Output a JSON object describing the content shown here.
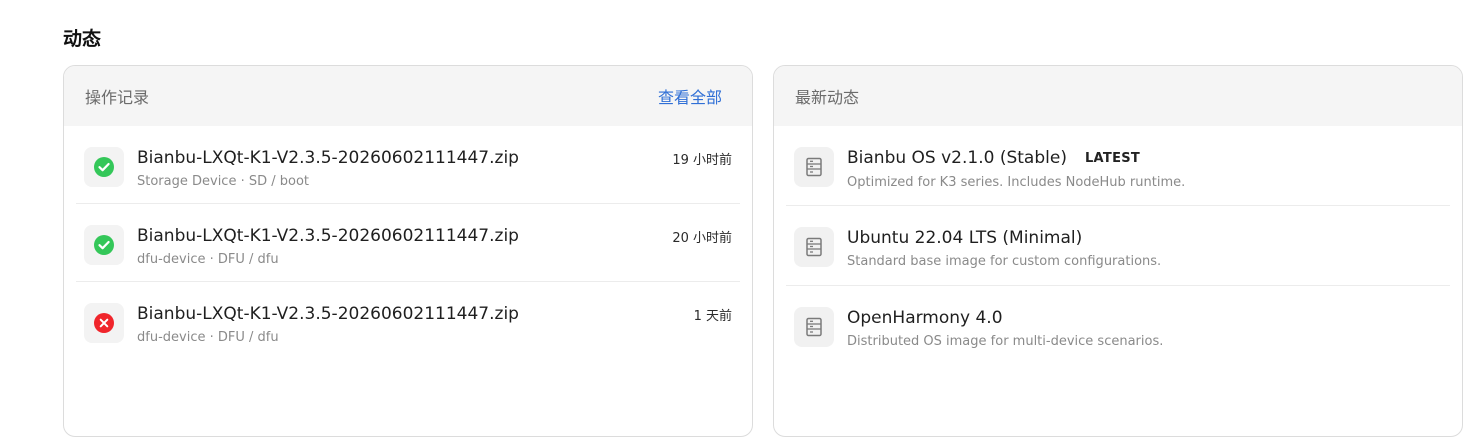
{
  "section": {
    "title": "动态"
  },
  "operations": {
    "title": "操作记录",
    "view_all": "查看全部",
    "items": [
      {
        "status": "success",
        "icon": "check-circle-icon",
        "name": "Bianbu-LXQt-K1-V2.3.5-20260602111447.zip",
        "target": "Storage Device · SD / boot",
        "time": "19 小时前"
      },
      {
        "status": "success",
        "icon": "check-circle-icon",
        "name": "Bianbu-LXQt-K1-V2.3.5-20260602111447.zip",
        "target": "dfu-device · DFU / dfu",
        "time": "20 小时前"
      },
      {
        "status": "error",
        "icon": "x-circle-icon",
        "name": "Bianbu-LXQt-K1-V2.3.5-20260602111447.zip",
        "target": "dfu-device · DFU / dfu",
        "time": "1 天前"
      }
    ]
  },
  "news": {
    "title": "最新动态",
    "items": [
      {
        "icon": "document-icon",
        "title": "Bianbu OS v2.1.0 (Stable)",
        "badge": "LATEST",
        "desc": "Optimized for K3 series. Includes NodeHub runtime."
      },
      {
        "icon": "document-icon",
        "title": "Ubuntu 22.04 LTS (Minimal)",
        "badge": "",
        "desc": "Standard base image for custom configurations."
      },
      {
        "icon": "document-icon",
        "title": "OpenHarmony 4.0",
        "badge": "",
        "desc": "Distributed OS image for multi-device scenarios."
      }
    ]
  },
  "colors": {
    "success": "#34c759",
    "error": "#f0252b",
    "link": "#2f6fd6"
  }
}
